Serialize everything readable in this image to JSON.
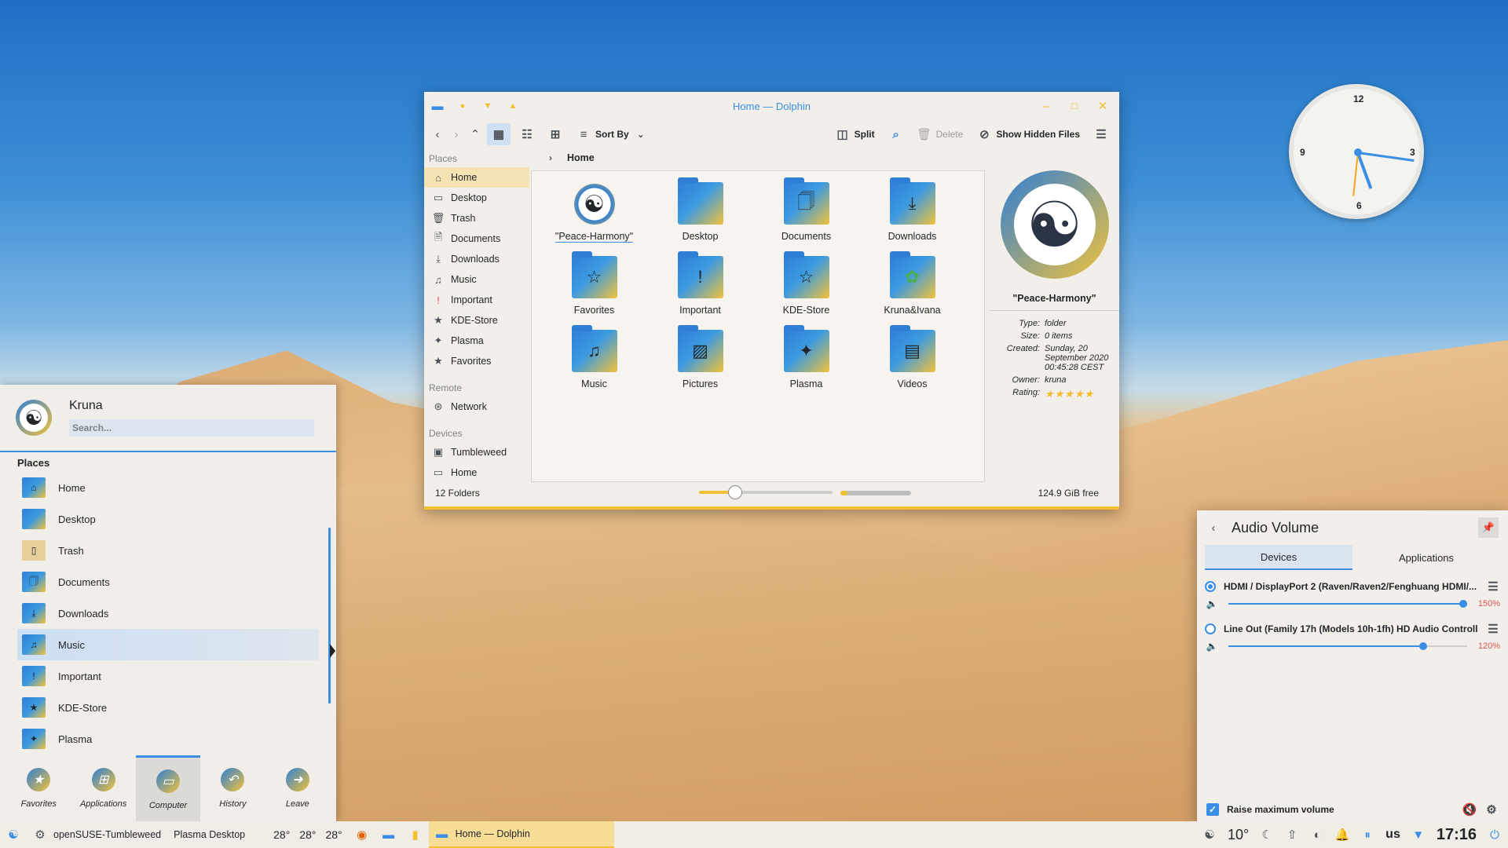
{
  "dolphin": {
    "title": "Home — Dolphin",
    "toolbar": {
      "sort_by": "Sort By",
      "split": "Split",
      "delete": "Delete",
      "show_hidden": "Show Hidden Files"
    },
    "places_header": "Places",
    "places": [
      "Home",
      "Desktop",
      "Trash",
      "Documents",
      "Downloads",
      "Music",
      "Important",
      "KDE-Store",
      "Plasma",
      "Favorites"
    ],
    "remote_header": "Remote",
    "remote": [
      "Network"
    ],
    "devices_header": "Devices",
    "devices": [
      "Tumbleweed",
      "Home"
    ],
    "breadcrumb": "Home",
    "files": [
      "\"Peace-Harmony\"",
      "Desktop",
      "Documents",
      "Downloads",
      "Favorites",
      "Important",
      "KDE-Store",
      "Kruna&Ivana",
      "Music",
      "Pictures",
      "Plasma",
      "Videos"
    ],
    "info": {
      "name": "\"Peace-Harmony\"",
      "type_k": "Type:",
      "type_v": "folder",
      "size_k": "Size:",
      "size_v": "0 items",
      "created_k": "Created:",
      "created_v": "Sunday, 20 September 2020 00:45:28 CEST",
      "owner_k": "Owner:",
      "owner_v": "kruna",
      "rating_k": "Rating:",
      "rating": 5
    },
    "status": {
      "count": "12 Folders",
      "free": "124.9 GiB free",
      "zoom_fraction": 0.27,
      "used_fraction": 0.1
    }
  },
  "menu": {
    "user": "Kruna",
    "search_placeholder": "Search...",
    "section": "Places",
    "items": [
      "Home",
      "Desktop",
      "Trash",
      "Documents",
      "Downloads",
      "Music",
      "Important",
      "KDE-Store",
      "Plasma"
    ],
    "tabs": [
      "Favorites",
      "Applications",
      "Computer",
      "History",
      "Leave"
    ]
  },
  "audio": {
    "title": "Audio Volume",
    "tabs": [
      "Devices",
      "Applications"
    ],
    "devices": [
      {
        "name": "HDMI / DisplayPort 2 (Raven/Raven2/Fenghuang HDMI/...",
        "volume": "150%"
      },
      {
        "name": "Line Out (Family 17h (Models 10h-1fh) HD Audio Controlle...",
        "volume": "120%"
      }
    ],
    "raise_label": "Raise maximum volume"
  },
  "clock": {
    "n12": "12",
    "n3": "3",
    "n6": "6",
    "n9": "9"
  },
  "taskbar": {
    "distro": "openSUSE-Tumbleweed",
    "activity": "Plasma Desktop",
    "temps": [
      "28°",
      "28°",
      "28°"
    ],
    "task": "Home — Dolphin",
    "weather": "10°",
    "layout": "us",
    "time": "17:16"
  }
}
